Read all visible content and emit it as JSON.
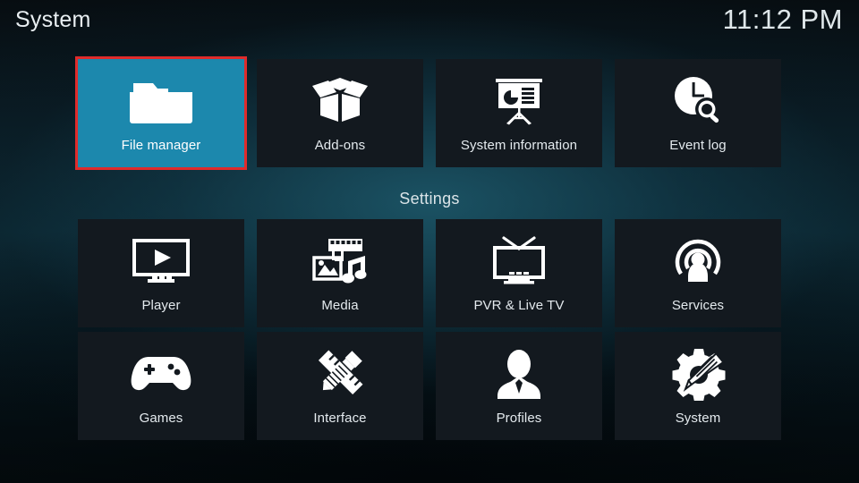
{
  "header": {
    "title": "System",
    "clock": "11:12 PM"
  },
  "section": {
    "label": "Settings"
  },
  "colors": {
    "focus_background": "#1c88ad",
    "focus_border": "#e02b2b",
    "tile_background": "#13191f",
    "text": "#e4eaee"
  },
  "rows": {
    "top": [
      {
        "label": "File manager",
        "icon": "folder-icon",
        "focused": true
      },
      {
        "label": "Add-ons",
        "icon": "open-box-icon",
        "focused": false
      },
      {
        "label": "System information",
        "icon": "presentation-icon",
        "focused": false
      },
      {
        "label": "Event log",
        "icon": "clock-search-icon",
        "focused": false
      }
    ],
    "middle": [
      {
        "label": "Player",
        "icon": "monitor-play-icon",
        "focused": false
      },
      {
        "label": "Media",
        "icon": "film-photo-music-icon",
        "focused": false
      },
      {
        "label": "PVR & Live TV",
        "icon": "television-icon",
        "focused": false
      },
      {
        "label": "Services",
        "icon": "broadcast-person-icon",
        "focused": false
      }
    ],
    "bottom": [
      {
        "label": "Games",
        "icon": "gamepad-icon",
        "focused": false
      },
      {
        "label": "Interface",
        "icon": "pencil-ruler-icon",
        "focused": false
      },
      {
        "label": "Profiles",
        "icon": "person-bust-icon",
        "focused": false
      },
      {
        "label": "System",
        "icon": "gear-wrench-icon",
        "focused": false
      }
    ]
  }
}
